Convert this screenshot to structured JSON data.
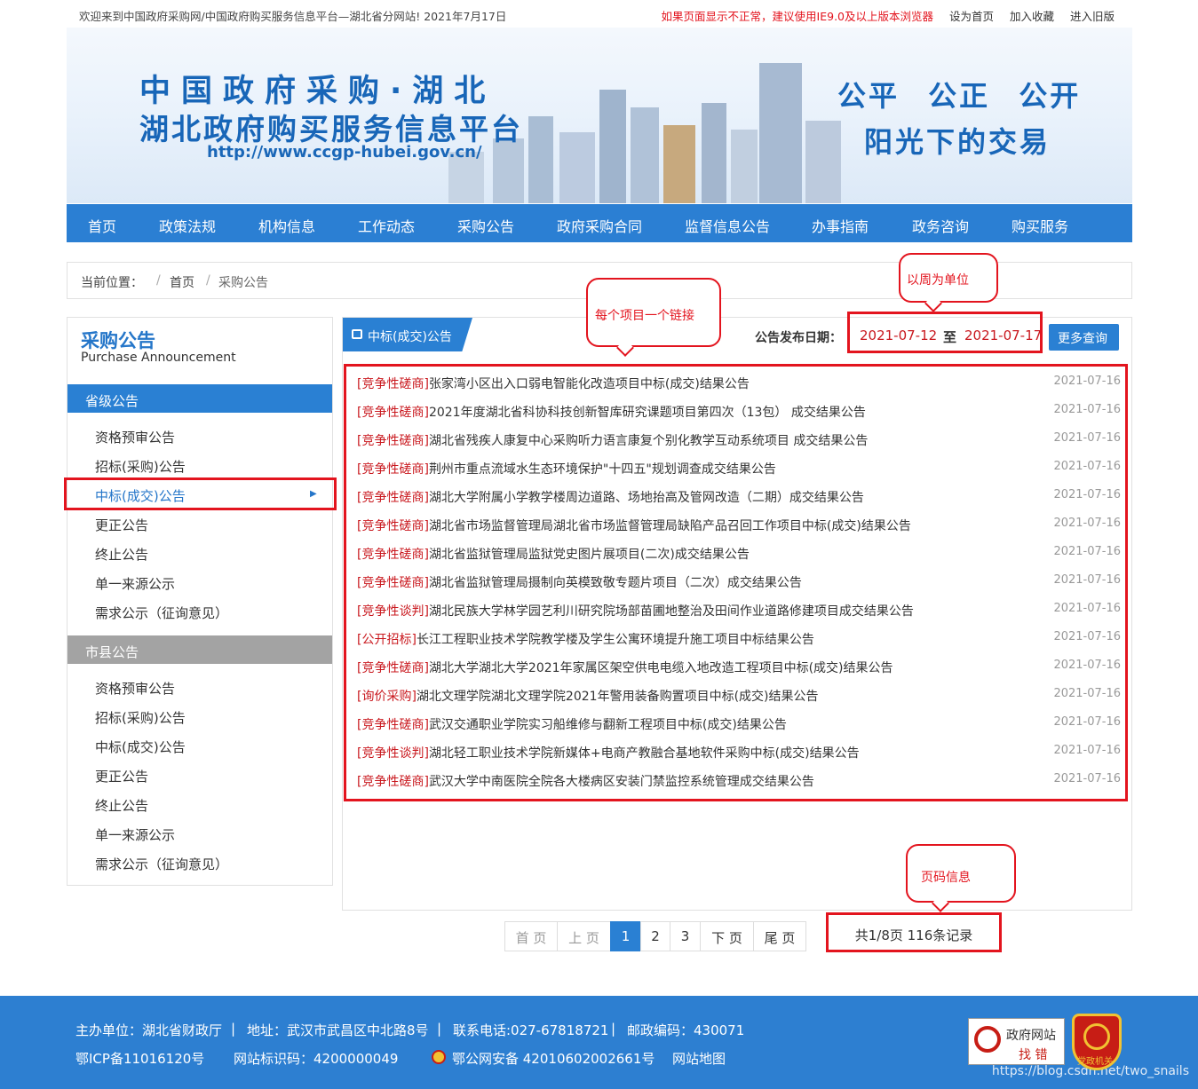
{
  "topbar": {
    "welcome": "欢迎来到中国政府采购网/中国政府购买服务信息平台—湖北省分网站!   2021年7月17日",
    "notice": "如果页面显示不正常，建议使用IE9.0及以上版本浏览器",
    "sethome": "设为首页",
    "favorite": "加入收藏",
    "oldversion": "进入旧版"
  },
  "banner": {
    "title1": "中国政府采购·湖北",
    "title2": "湖北政府购买服务信息平台",
    "url": "http://www.ccgp-hubei.gov.cn/",
    "slogan1": "公平 公正 公开",
    "slogan2": "阳光下的交易"
  },
  "nav": [
    "首页",
    "政策法规",
    "机构信息",
    "工作动态",
    "采购公告",
    "政府采购合同",
    "监督信息公告",
    "办事指南",
    "政务咨询",
    "购买服务"
  ],
  "breadcrumb": {
    "label": "当前位置：",
    "sep": "/",
    "home": "首页",
    "current": "采购公告"
  },
  "sidebar": {
    "title": "采购公告",
    "subtitle": "Purchase Announcement",
    "section1": "省级公告",
    "items1": [
      "资格预审公告",
      "招标(采购)公告",
      "中标(成交)公告",
      "更正公告",
      "终止公告",
      "单一来源公示",
      "需求公示（征询意见）"
    ],
    "section2": "市县公告",
    "items2": [
      "资格预审公告",
      "招标(采购)公告",
      "中标(成交)公告",
      "更正公告",
      "终止公告",
      "单一来源公示",
      "需求公示（征询意见）"
    ]
  },
  "list": {
    "tab": "中标(成交)公告",
    "date_label": "公告发布日期：",
    "date_from": "2021-07-12",
    "date_to_word": "至",
    "date_to": "2021-07-17",
    "more": "更多查询",
    "rows": [
      {
        "tag": "[竞争性磋商]",
        "title": "张家湾小区出入口弱电智能化改造项目中标(成交)结果公告",
        "date": "2021-07-16"
      },
      {
        "tag": "[竞争性磋商]",
        "title": "2021年度湖北省科协科技创新智库研究课题项目第四次（13包） 成交结果公告",
        "date": "2021-07-16"
      },
      {
        "tag": "[竞争性磋商]",
        "title": "湖北省残疾人康复中心采购听力语言康复个别化教学互动系统项目 成交结果公告",
        "date": "2021-07-16"
      },
      {
        "tag": "[竞争性磋商]",
        "title": "荆州市重点流域水生态环境保护\"十四五\"规划调查成交结果公告",
        "date": "2021-07-16"
      },
      {
        "tag": "[竞争性磋商]",
        "title": "湖北大学附属小学教学楼周边道路、场地抬高及管网改造（二期）成交结果公告",
        "date": "2021-07-16"
      },
      {
        "tag": "[竞争性磋商]",
        "title": "湖北省市场监督管理局湖北省市场监督管理局缺陷产品召回工作项目中标(成交)结果公告",
        "date": "2021-07-16"
      },
      {
        "tag": "[竞争性磋商]",
        "title": "湖北省监狱管理局监狱党史图片展项目(二次)成交结果公告",
        "date": "2021-07-16"
      },
      {
        "tag": "[竞争性磋商]",
        "title": "湖北省监狱管理局摄制向英模致敬专题片项目（二次）成交结果公告",
        "date": "2021-07-16"
      },
      {
        "tag": "[竞争性谈判]",
        "title": "湖北民族大学林学园艺利川研究院场部苗圃地整治及田间作业道路修建项目成交结果公告",
        "date": "2021-07-16"
      },
      {
        "tag": "[公开招标]",
        "title": "长江工程职业技术学院教学楼及学生公寓环境提升施工项目中标结果公告",
        "date": "2021-07-16"
      },
      {
        "tag": "[竞争性磋商]",
        "title": "湖北大学湖北大学2021年家属区架空供电电缆入地改造工程项目中标(成交)结果公告",
        "date": "2021-07-16"
      },
      {
        "tag": "[询价采购]",
        "title": "湖北文理学院湖北文理学院2021年警用装备购置项目中标(成交)结果公告",
        "date": "2021-07-16"
      },
      {
        "tag": "[竞争性磋商]",
        "title": "武汉交通职业学院实习船维修与翻新工程项目中标(成交)结果公告",
        "date": "2021-07-16"
      },
      {
        "tag": "[竞争性谈判]",
        "title": "湖北轻工职业技术学院新媒体+电商产教融合基地软件采购中标(成交)结果公告",
        "date": "2021-07-16"
      },
      {
        "tag": "[竞争性磋商]",
        "title": "武汉大学中南医院全院各大楼病区安装门禁监控系统管理成交结果公告",
        "date": "2021-07-16"
      }
    ]
  },
  "pagination": {
    "first": "首 页",
    "prev": "上 页",
    "pages": [
      "1",
      "2",
      "3"
    ],
    "next": "下 页",
    "last": "尾 页",
    "info": "共1/8页 116条记录"
  },
  "annotations": {
    "weekly": "以周为单位",
    "per_item_link": "每个项目一个链接",
    "page_info": "页码信息"
  },
  "footer": {
    "host": "主办单位：湖北省财政厅",
    "address": "地址：武汉市武昌区中北路8号",
    "phone": "联系电话:027-67818721",
    "postcode": "邮政编码：430071",
    "icp": "鄂ICP备11016120号",
    "site_id": "网站标识码：4200000049",
    "police": "鄂公网安备 42010602002661号",
    "sitemap": "网站地图",
    "jiucuo_line1": "政府网站",
    "jiucuo_line2": "找 错",
    "badge_text": "党政机关",
    "watermark": "https://blog.csdn.net/two_snails"
  },
  "colors": {
    "primary": "#2b7fd3",
    "tag_red": "#c9181e",
    "annotation_red": "#e3141e",
    "footer": "#2d7fd1"
  }
}
